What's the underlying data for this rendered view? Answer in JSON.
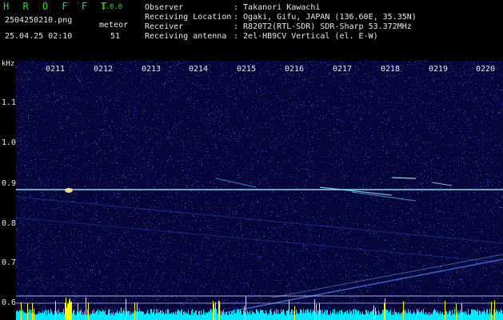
{
  "header": {
    "app_name": "H R O F F T",
    "version": "1.0.0",
    "filename": "2504250210.png",
    "datetime": "25.04.25 02:10",
    "meteor_label": "meteor",
    "meteor_count": "51"
  },
  "station": [
    {
      "key": "Observer",
      "value": ": Takanori Kawachi"
    },
    {
      "key": "Receiving Location",
      "value": ": Ogaki, Gifu, JAPAN (136.60E, 35.35N)"
    },
    {
      "key": "Receiver",
      "value": ": R820T2(RTL-SDR) SDR-Sharp 53.372MHz"
    },
    {
      "key": "Receiving antenna",
      "value": ": 2el-HB9CV Vertical (el. E-W)"
    }
  ],
  "axis": {
    "unit": "kHz",
    "y_ticks": [
      "1.1",
      "1.0",
      "0.9",
      "0.8",
      "0.7",
      "0.6"
    ],
    "x_ticks": [
      "0211",
      "0212",
      "0213",
      "0214",
      "0215",
      "0216",
      "0217",
      "0218",
      "0219",
      "0220"
    ]
  },
  "colors": {
    "title_green": "#2cd62c",
    "background": "#06063a",
    "carrier": "#9ef0ff",
    "noise_floor": "#00e8ff",
    "burst": "#ffff00"
  }
}
